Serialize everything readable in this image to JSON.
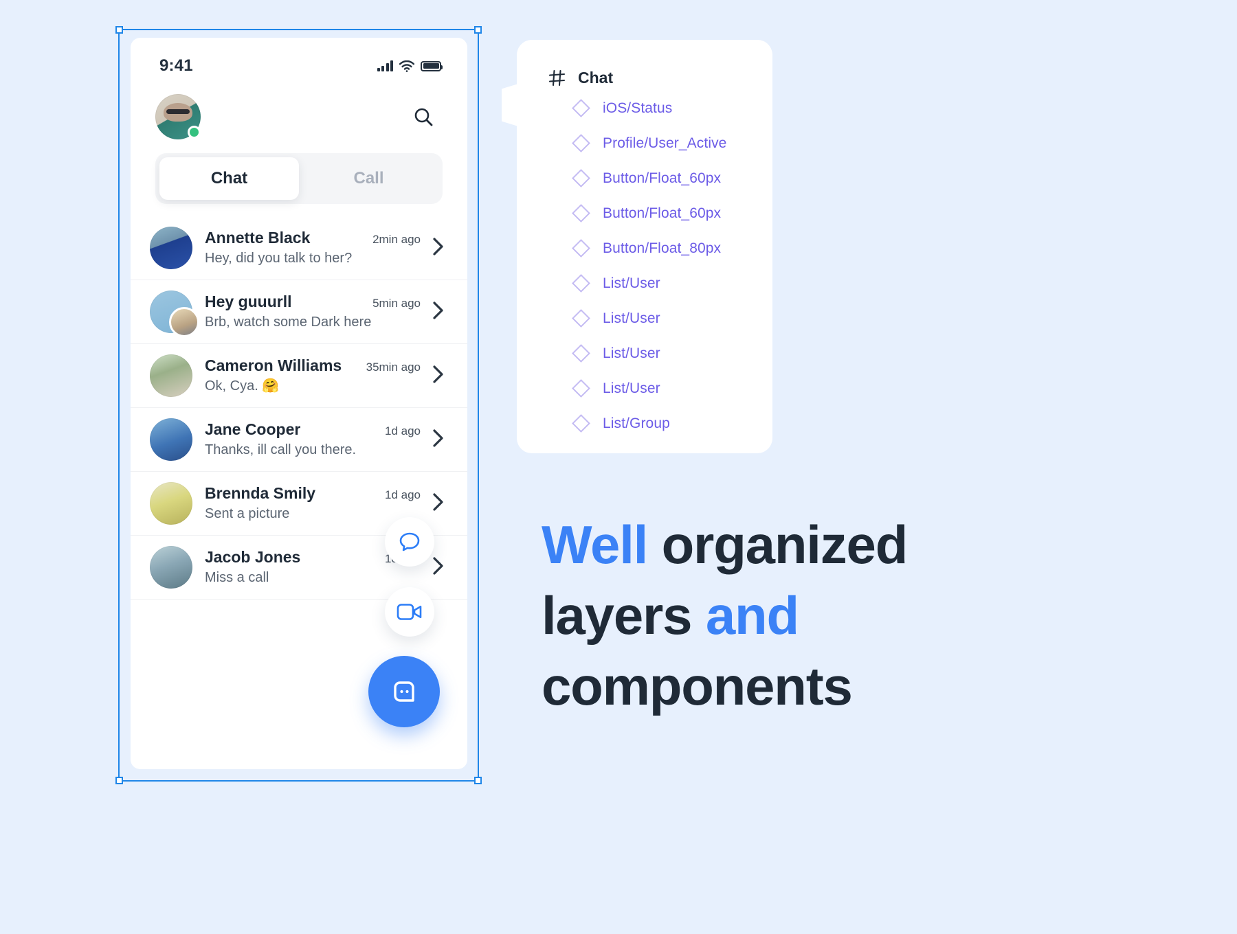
{
  "canvas": {
    "background": "#E7F0FD",
    "accent": "#3B82F6",
    "layer_color": "#6C5CE7"
  },
  "phone": {
    "status_bar": {
      "time": "9:41",
      "signal_icon": "signal-bars-icon",
      "wifi_icon": "wifi-icon",
      "battery_icon": "battery-icon"
    },
    "header": {
      "avatar_name": "avatar",
      "online_status": "online",
      "search_icon": "search-icon"
    },
    "tabs": [
      {
        "label": "Chat",
        "active": true
      },
      {
        "label": "Call",
        "active": false
      }
    ],
    "chats": [
      {
        "name": "Annette Black",
        "message": "Hey, did you talk to her?",
        "time": "2min ago"
      },
      {
        "name": "Hey guuurll",
        "message": "Brb, watch some Dark here",
        "time": "5min ago"
      },
      {
        "name": "Cameron Williams",
        "message": "Ok, Cya.  🤗",
        "time": "35min ago"
      },
      {
        "name": "Jane Cooper",
        "message": "Thanks, ill call you there.",
        "time": "1d ago"
      },
      {
        "name": "Brennda Smily",
        "message": "Sent a picture",
        "time": "1d ago"
      },
      {
        "name": "Jacob Jones",
        "message": "Miss a call",
        "time": "1d ago"
      }
    ],
    "floating_buttons": [
      {
        "icon": "chat-bubble-icon",
        "style": "white"
      },
      {
        "icon": "video-camera-icon",
        "style": "white"
      },
      {
        "icon": "message-dots-icon",
        "style": "blue"
      }
    ]
  },
  "layers_panel": {
    "frame_icon": "hash-frame-icon",
    "title": "Chat",
    "items": [
      {
        "label": "iOS/Status"
      },
      {
        "label": "Profile/User_Active"
      },
      {
        "label": "Button/Float_60px"
      },
      {
        "label": "Button/Float_60px"
      },
      {
        "label": "Button/Float_80px"
      },
      {
        "label": "List/User"
      },
      {
        "label": "List/User"
      },
      {
        "label": "List/User"
      },
      {
        "label": "List/User"
      },
      {
        "label": "List/Group"
      }
    ]
  },
  "headline": {
    "line1_a": "Well ",
    "line1_b": "organized",
    "line2_a": "layers ",
    "line2_b": "and",
    "line3": "components"
  }
}
